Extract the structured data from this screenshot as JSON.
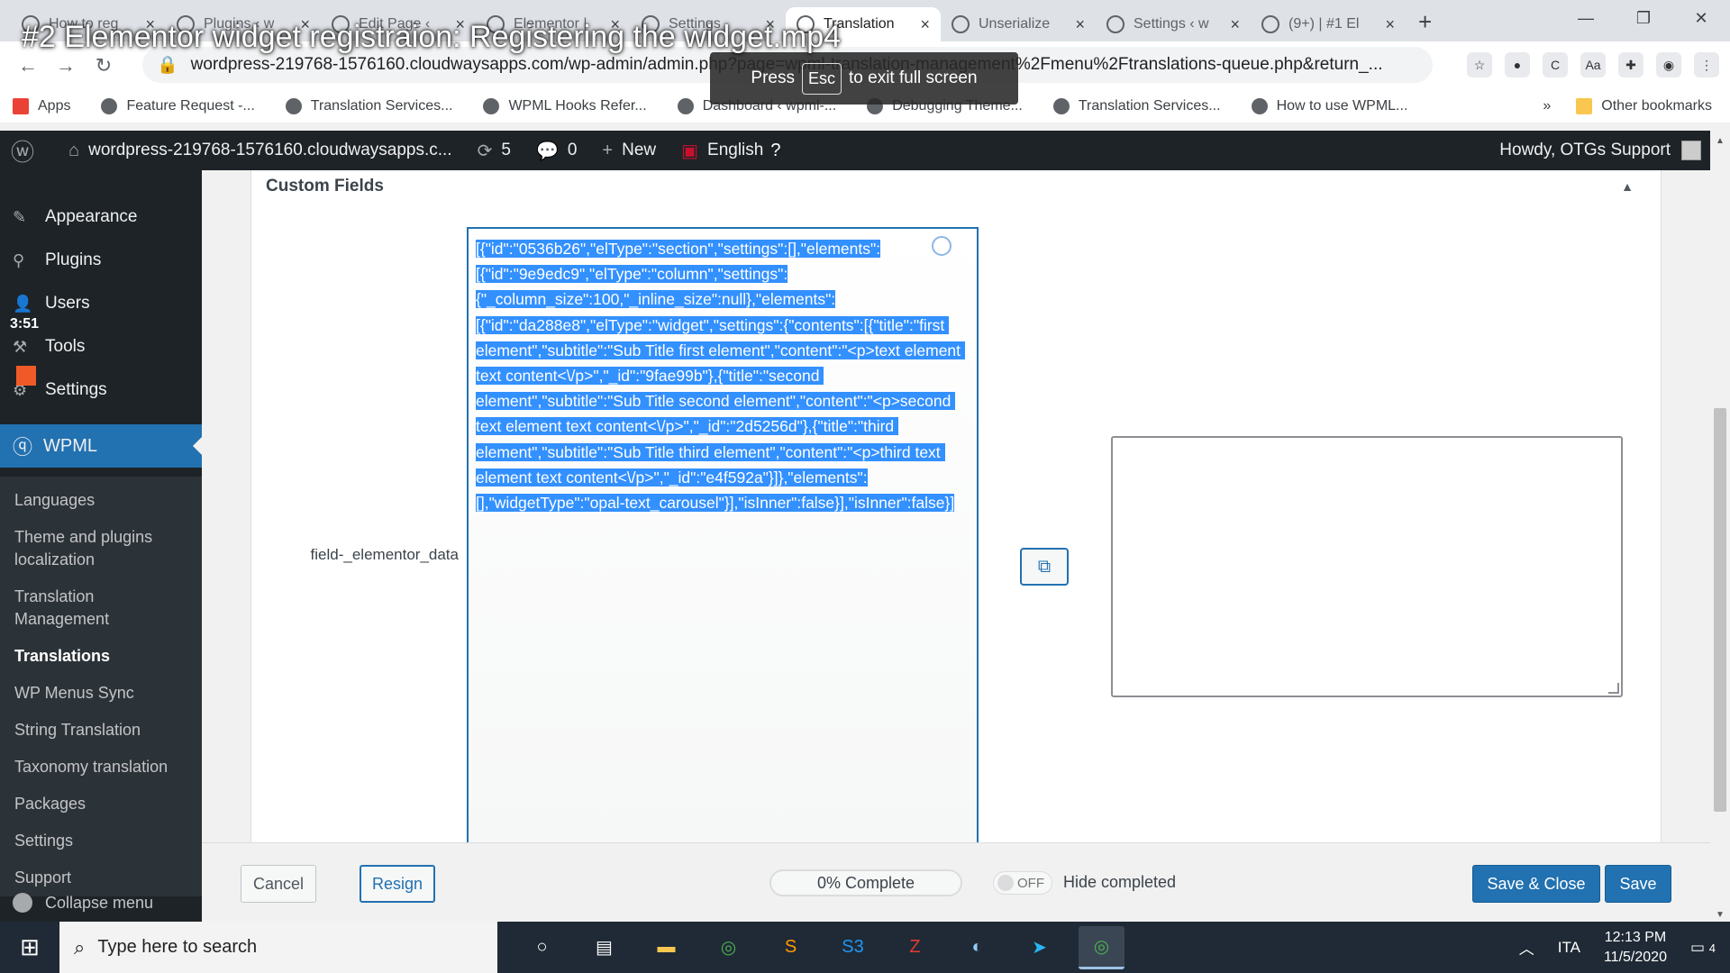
{
  "video_title": "#2 Elementor widget registraion: Registering the widget.mp4",
  "fullscreen_msg": {
    "press": "Press",
    "key": "Esc",
    "rest": "to exit full screen"
  },
  "browser": {
    "tabs": [
      {
        "title": "How to reg",
        "icon": "wpml-icon"
      },
      {
        "title": "Plugins ‹ w",
        "icon": "wordpress-icon"
      },
      {
        "title": "Edit Page ‹",
        "icon": "wordpress-icon"
      },
      {
        "title": "Elementor |",
        "icon": "wordpress-icon"
      },
      {
        "title": "Settings",
        "icon": "wordpress-icon"
      },
      {
        "title": "Translation",
        "icon": "wordpress-icon",
        "active": true
      },
      {
        "title": "Unserialize",
        "icon": "page-icon"
      },
      {
        "title": "Settings ‹ w",
        "icon": "wordpress-icon"
      },
      {
        "title": "(9+) | #1 El",
        "icon": "gear-icon"
      }
    ],
    "url": "wordpress-219768-1576160.cloudwaysapps.com/wp-admin/admin.php?page=wpml-translation-management%2Fmenu%2Ftranslations-queue.php&return_...",
    "bookmarks": [
      "Apps",
      "Feature Request -...",
      "Translation Services...",
      "WPML Hooks Refer...",
      "Dashboard ‹ wpml-...",
      "Debugging Theme...",
      "Translation Services...",
      "How to use WPML..."
    ],
    "bookmarks_more": "»",
    "other_bookmarks": "Other bookmarks"
  },
  "adminbar": {
    "site": "wordpress-219768-1576160.cloudwaysapps.c...",
    "updates": "5",
    "comments": "0",
    "new": "New",
    "language": "English",
    "howdy": "Howdy, OTGs Support"
  },
  "sidebar": {
    "items": [
      "Appearance",
      "Plugins",
      "Users",
      "Tools",
      "Settings"
    ],
    "wpml": "WPML",
    "submenu": [
      "Languages",
      "Theme and plugins localization",
      "Translation Management",
      "Translations",
      "WP Menus Sync",
      "String Translation",
      "Taxonomy translation",
      "Packages",
      "Settings",
      "Support"
    ],
    "collapse": "Collapse menu",
    "time_badge": "3:51"
  },
  "editor": {
    "section_title": "Custom Fields",
    "field_label": "field-_elementor_data",
    "source_text": "[{\"id\":\"0536b26\",\"elType\":\"section\",\"settings\":[],\"elements\":[{\"id\":\"9e9edc9\",\"elType\":\"column\",\"settings\":{\"_column_size\":100,\"_inline_size\":null},\"elements\":[{\"id\":\"da288e8\",\"elType\":\"widget\",\"settings\":{\"contents\":[{\"title\":\"first element\",\"subtitle\":\"Sub Title first element\",\"content\":\"<p>text element text content<\\/p>\",\"_id\":\"9fae99b\"},{\"title\":\"second element\",\"subtitle\":\"Sub Title second element\",\"content\":\"<p>second text element text content<\\/p>\",\"_id\":\"2d5256d\"},{\"title\":\"third element\",\"subtitle\":\"Sub Title third element\",\"content\":\"<p>third text element text content<\\/p>\",\"_id\":\"e4f592a\"}]},\"elements\":[],\"widgetType\":\"opal-text_carousel\"}],\"isInner\":false}],\"isInner\":false}]",
    "translation_text": ""
  },
  "footer": {
    "cancel": "Cancel",
    "resign": "Resign",
    "progress": "0% Complete",
    "progress_value": 0,
    "toggle": "OFF",
    "hide_completed": "Hide completed",
    "save_close": "Save & Close",
    "save": "Save"
  },
  "taskbar": {
    "search_placeholder": "Type here to search",
    "lang": "ITA",
    "time": "12:13 PM",
    "date": "11/5/2020",
    "notifications": "4"
  }
}
